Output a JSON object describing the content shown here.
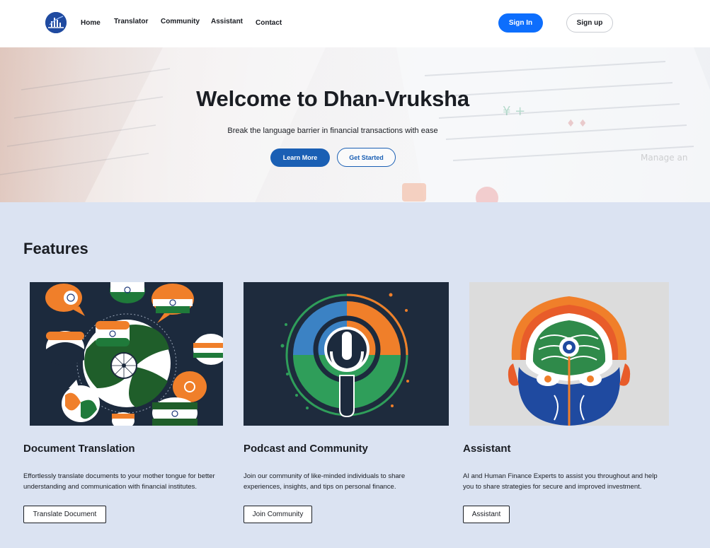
{
  "nav": {
    "links": [
      "Home",
      "Translator",
      "Community",
      "Assistant",
      "Contact"
    ],
    "sign_in": "Sign In",
    "sign_up": "Sign up"
  },
  "hero": {
    "title": "Welcome to Dhan-Vruksha",
    "subtitle": "Break the language barrier in financial transactions with ease",
    "learn_more": "Learn More",
    "get_started": "Get Started"
  },
  "features": {
    "heading": "Features",
    "cards": [
      {
        "title": "Document Translation",
        "text_line1": "Effortlessly translate documents to your mother tongue for better",
        "text_line2": "understanding and communication with financial institutes.",
        "button": "Translate Document",
        "image_icon": "globe-speech-bubbles-icon"
      },
      {
        "title": "Podcast and Community",
        "text_line1": "Join our community of like-minded individuals to share",
        "text_line2": "experiences, insights, and tips on personal finance.",
        "button": "Join Community",
        "image_icon": "microphone-icon"
      },
      {
        "title": "Assistant",
        "text_line1": "AI and Human Finance Experts to assist you throughout and help",
        "text_line2": "you to share strategies for secure and improved investment.",
        "button": "Assistant",
        "image_icon": "ai-head-icon"
      }
    ]
  },
  "colors": {
    "primary": "#0d6efd",
    "hero_button": "#1a5fb4",
    "features_bg": "#dbe3f2",
    "saffron": "#f07f2a",
    "green": "#1f7a3a",
    "navy": "#1c2a3d"
  }
}
